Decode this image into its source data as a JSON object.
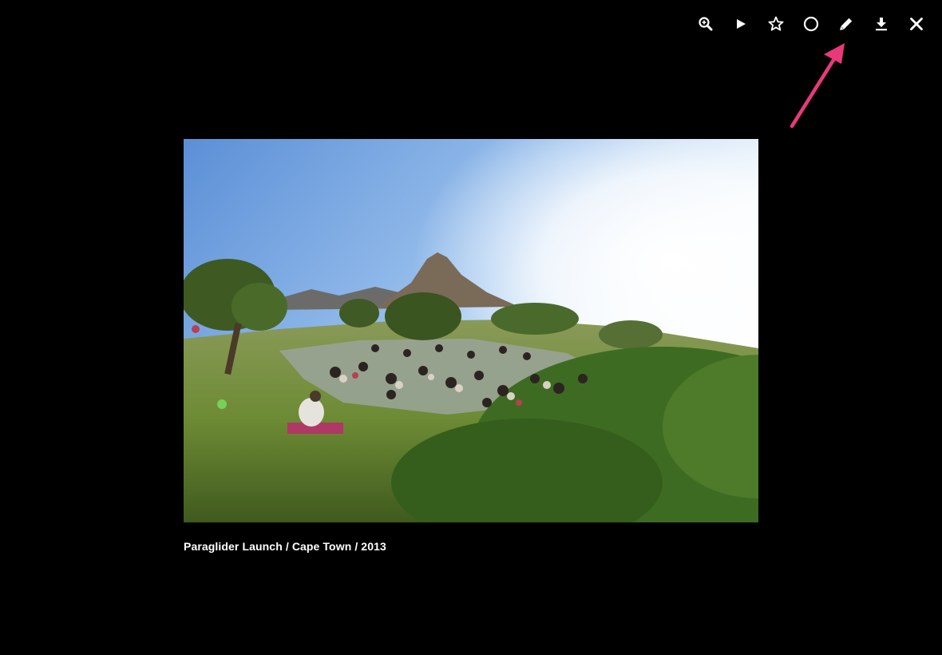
{
  "toolbar": {
    "buttons": [
      {
        "icon": "zoom-icon"
      },
      {
        "icon": "play-icon"
      },
      {
        "icon": "star-icon"
      },
      {
        "icon": "circle-icon"
      },
      {
        "icon": "pencil-icon"
      },
      {
        "icon": "download-icon"
      },
      {
        "icon": "close-icon"
      }
    ]
  },
  "photo": {
    "caption": "Paraglider Launch / Cape Town / 2013"
  },
  "annotation": {
    "arrow_color": "#e8397a",
    "points_to": "pencil-icon"
  }
}
